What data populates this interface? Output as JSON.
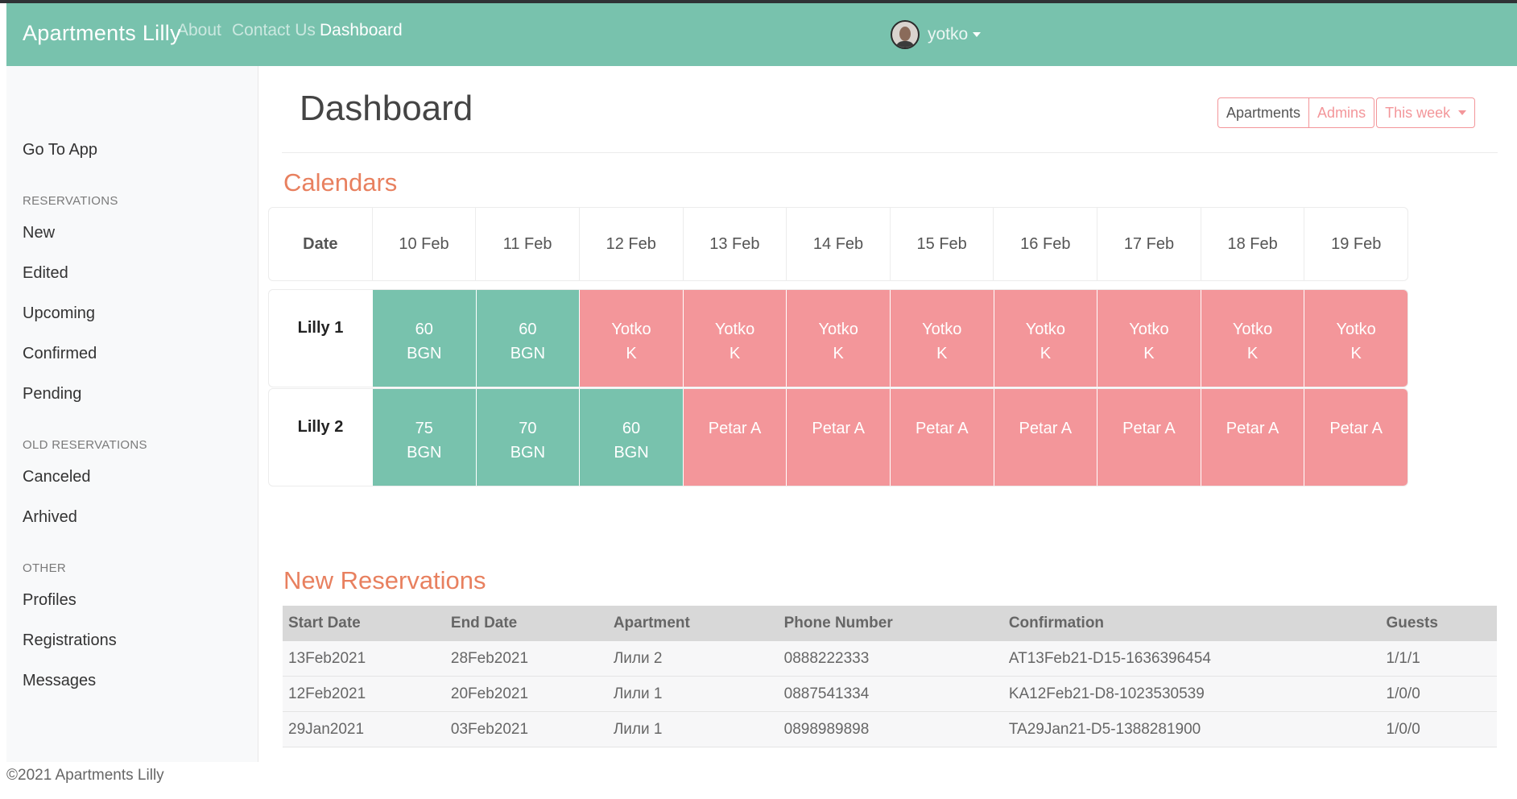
{
  "navbar": {
    "brand": "Apartments Lilly",
    "links": [
      "About",
      "Contact Us",
      "Dashboard"
    ],
    "user": "yotko"
  },
  "sidebar": {
    "go_to_app": "Go To App",
    "sections": [
      {
        "heading": "RESERVATIONS",
        "items": [
          "New",
          "Edited",
          "Upcoming",
          "Confirmed",
          "Pending"
        ]
      },
      {
        "heading": "OLD RESERVATIONS",
        "items": [
          "Canceled",
          "Arhived"
        ]
      },
      {
        "heading": "OTHER",
        "items": [
          "Profiles",
          "Registrations",
          "Messages"
        ]
      }
    ]
  },
  "main": {
    "title": "Dashboard",
    "buttons": {
      "apartments": "Apartments",
      "admins": "Admins",
      "period": "This week"
    },
    "calendars_title": "Calendars",
    "new_reservations_title": "New Reservations"
  },
  "calendar": {
    "date_header": "Date",
    "dates": [
      "10 Feb",
      "11 Feb",
      "12 Feb",
      "13 Feb",
      "14 Feb",
      "15 Feb",
      "16 Feb",
      "17 Feb",
      "18 Feb",
      "19 Feb"
    ],
    "rows": [
      {
        "name": "Lilly 1",
        "cells": [
          {
            "status": "free",
            "line1": "60",
            "line2": "BGN"
          },
          {
            "status": "free",
            "line1": "60",
            "line2": "BGN"
          },
          {
            "status": "busy",
            "line1": "Yotko",
            "line2": "K"
          },
          {
            "status": "busy",
            "line1": "Yotko",
            "line2": "K"
          },
          {
            "status": "busy",
            "line1": "Yotko",
            "line2": "K"
          },
          {
            "status": "busy",
            "line1": "Yotko",
            "line2": "K"
          },
          {
            "status": "busy",
            "line1": "Yotko",
            "line2": "K"
          },
          {
            "status": "busy",
            "line1": "Yotko",
            "line2": "K"
          },
          {
            "status": "busy",
            "line1": "Yotko",
            "line2": "K"
          },
          {
            "status": "busy",
            "line1": "Yotko",
            "line2": "K"
          }
        ]
      },
      {
        "name": "Lilly 2",
        "cells": [
          {
            "status": "free",
            "line1": "75",
            "line2": "BGN"
          },
          {
            "status": "free",
            "line1": "70",
            "line2": "BGN"
          },
          {
            "status": "free",
            "line1": "60",
            "line2": "BGN"
          },
          {
            "status": "busy",
            "line1": "Petar A",
            "line2": ""
          },
          {
            "status": "busy",
            "line1": "Petar A",
            "line2": ""
          },
          {
            "status": "busy",
            "line1": "Petar A",
            "line2": ""
          },
          {
            "status": "busy",
            "line1": "Petar A",
            "line2": ""
          },
          {
            "status": "busy",
            "line1": "Petar A",
            "line2": ""
          },
          {
            "status": "busy",
            "line1": "Petar A",
            "line2": ""
          },
          {
            "status": "busy",
            "line1": "Petar A",
            "line2": ""
          }
        ]
      }
    ]
  },
  "reservations": {
    "headers": [
      "Start Date",
      "End Date",
      "Apartment",
      "Phone Number",
      "Confirmation",
      "Guests"
    ],
    "rows": [
      [
        "13Feb2021",
        "28Feb2021",
        "Лили 2",
        "0888222333",
        "AT13Feb21-D15-1636396454",
        "1/1/1"
      ],
      [
        "12Feb2021",
        "20Feb2021",
        "Лили 1",
        "0887541334",
        "KA12Feb21-D8-1023530539",
        "1/0/0"
      ],
      [
        "29Jan2021",
        "03Feb2021",
        "Лили 1",
        "0898989898",
        "TA29Jan21-D5-1388281900",
        "1/0/0"
      ]
    ]
  },
  "footer": "©2021 Apartments Lilly",
  "colors": {
    "primary": "#78c2ad",
    "danger": "#f3969a",
    "accent": "#e8805f"
  }
}
